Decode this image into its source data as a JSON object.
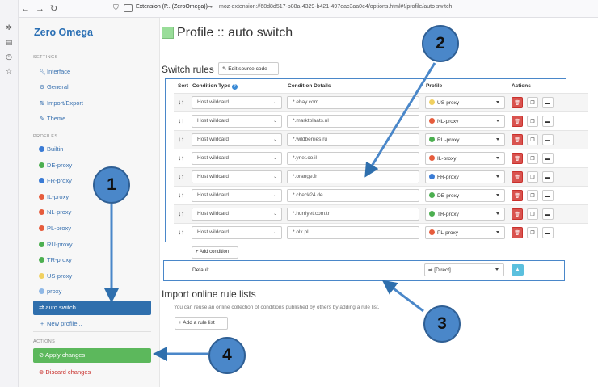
{
  "browser": {
    "site_label": "Extension (P...(ZeroOmega))",
    "url": "moz-extension://68d8d517-b88a-4329-b421-497eac3aa0e4/options.html#!/profile/auto switch"
  },
  "sidebar": {
    "app_title": "Zero Omega",
    "settings_header": "SETTINGS",
    "settings": [
      "Interface",
      "General",
      "Import/Export",
      "Theme"
    ],
    "profiles_header": "PROFILES",
    "profiles": [
      {
        "label": "Builtin",
        "color": "#3a7bd5"
      },
      {
        "label": "DE-proxy",
        "color": "#4caf50"
      },
      {
        "label": "FR-proxy",
        "color": "#3a7bd5"
      },
      {
        "label": "IL-proxy",
        "color": "#e65c3c"
      },
      {
        "label": "NL-proxy",
        "color": "#e65c3c"
      },
      {
        "label": "PL-proxy",
        "color": "#e65c3c"
      },
      {
        "label": "RU-proxy",
        "color": "#4caf50"
      },
      {
        "label": "TR-proxy",
        "color": "#4caf50"
      },
      {
        "label": "US-proxy",
        "color": "#f0d060"
      },
      {
        "label": "proxy",
        "color": "#8fb8e6"
      }
    ],
    "selected": "auto switch",
    "new_profile": "New profile...",
    "actions_header": "ACTIONS",
    "apply": "Apply changes",
    "discard": "Discard changes"
  },
  "main": {
    "title": "Profile :: auto switch",
    "switch_rules_title": "Switch rules",
    "edit_source": "Edit source code",
    "headers": {
      "sort": "Sort",
      "ctype": "Condition Type",
      "cdetails": "Condition Details",
      "profile": "Profile",
      "actions": "Actions"
    },
    "rules": [
      {
        "type": "Host wildcard",
        "value": "*.ebay.com",
        "profile": "US-proxy",
        "color": "#f0d060"
      },
      {
        "type": "Host wildcard",
        "value": "*.marktplaats.nl",
        "profile": "NL-proxy",
        "color": "#e65c3c"
      },
      {
        "type": "Host wildcard",
        "value": "*.wildberries.ru",
        "profile": "RU-proxy",
        "color": "#4caf50"
      },
      {
        "type": "Host wildcard",
        "value": "*.ynet.co.il",
        "profile": "IL-proxy",
        "color": "#e65c3c"
      },
      {
        "type": "Host wildcard",
        "value": "*.orange.fr",
        "profile": "FR-proxy",
        "color": "#3a7bd5"
      },
      {
        "type": "Host wildcard",
        "value": "*.check24.de",
        "profile": "DE-proxy",
        "color": "#4caf50"
      },
      {
        "type": "Host wildcard",
        "value": "*.hurriyet.com.tr",
        "profile": "TR-proxy",
        "color": "#4caf50"
      },
      {
        "type": "Host wildcard",
        "value": "*.olx.pl",
        "profile": "PL-proxy",
        "color": "#e65c3c"
      }
    ],
    "add_condition": "Add condition",
    "default_label": "Default",
    "default_profile": "[Direct]",
    "import_title": "Import online rule lists",
    "import_desc": "You can reuse an online collection of conditions published by others by adding a rule list.",
    "add_rule_list": "Add a rule list"
  },
  "annotations": [
    "1",
    "2",
    "3",
    "4"
  ]
}
